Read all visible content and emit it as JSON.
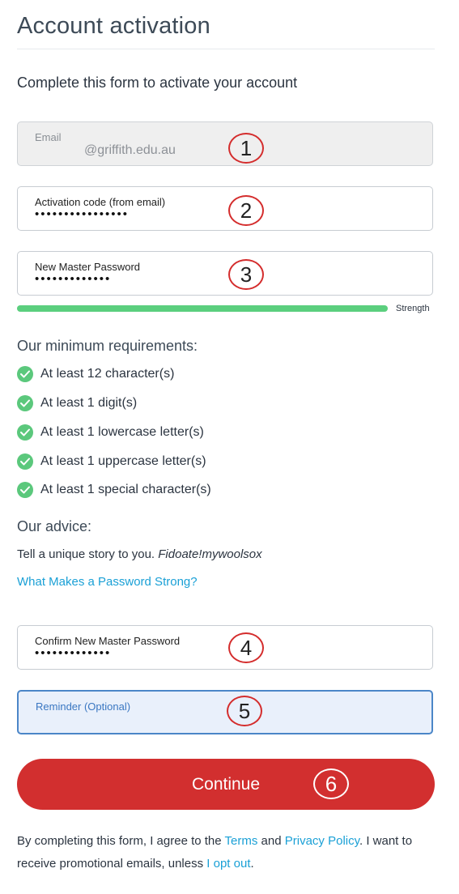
{
  "page": {
    "title": "Account activation",
    "subtitle": "Complete this form to activate your account"
  },
  "fields": {
    "email": {
      "label": "Email",
      "value": "@griffith.edu.au"
    },
    "activation_code": {
      "label": "Activation code (from email)",
      "masked_value": "••••••••••••••••"
    },
    "new_password": {
      "label": "New Master Password",
      "masked_value": "•••••••••••••"
    },
    "confirm_password": {
      "label": "Confirm New Master Password",
      "masked_value": "•••••••••••••"
    },
    "reminder": {
      "label": "Reminder (Optional)",
      "value": ""
    }
  },
  "strength": {
    "label": "Strength",
    "level": 1.0,
    "color": "#5bcf7e"
  },
  "requirements": {
    "heading": "Our minimum requirements:",
    "items": [
      "At least 12 character(s)",
      "At least 1 digit(s)",
      "At least 1 lowercase letter(s)",
      "At least 1 uppercase letter(s)",
      "At least 1 special character(s)"
    ]
  },
  "advice": {
    "heading": "Our advice:",
    "text": "Tell a unique story to you. ",
    "example": "Fidoate!mywoolsox",
    "link": "What Makes a Password Strong?"
  },
  "annotations": [
    "1",
    "2",
    "3",
    "4",
    "5",
    "6"
  ],
  "continue_label": "Continue",
  "legal": {
    "part1": "By completing this form, I agree to the ",
    "terms": "Terms",
    "part2": " and ",
    "privacy": "Privacy Policy",
    "part3": ". I want to receive promotional emails, unless ",
    "opt_out": "I opt out",
    "part4": "."
  },
  "colors": {
    "accent": "#d22f2f",
    "link": "#1aa0d6",
    "check": "#5bc87c",
    "focus": "#4b86c8"
  }
}
